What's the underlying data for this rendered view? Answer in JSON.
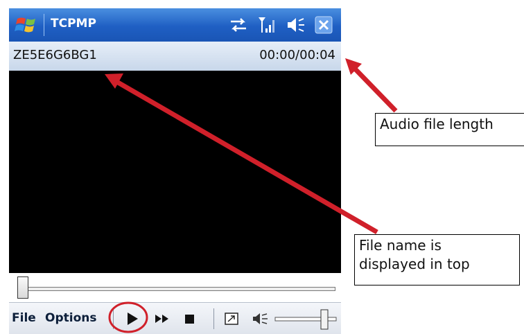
{
  "window": {
    "title": "TCPMP"
  },
  "info_bar": {
    "file_name": "ZE5E6G6BG1",
    "time": "00:00/00:04"
  },
  "menu_bar": {
    "file_label": "File",
    "options_label": "Options"
  },
  "playback": {
    "seek_position_fraction": 0.0,
    "volume_fraction": 0.85
  },
  "annotations": {
    "audio_length_label": "Audio file length",
    "file_name_label_lines": [
      "File name is",
      "displayed in top"
    ]
  },
  "colors": {
    "titlebar": "#1f5fc3",
    "annotation_arrow": "#d0202a",
    "annotation_circle": "#d0202a"
  },
  "icons": [
    "windows-flag-icon",
    "connection-icon",
    "signal-icon",
    "volume-icon",
    "close-icon",
    "play-icon",
    "fast-forward-icon",
    "stop-icon",
    "fullscreen-icon",
    "mute-icon"
  ]
}
